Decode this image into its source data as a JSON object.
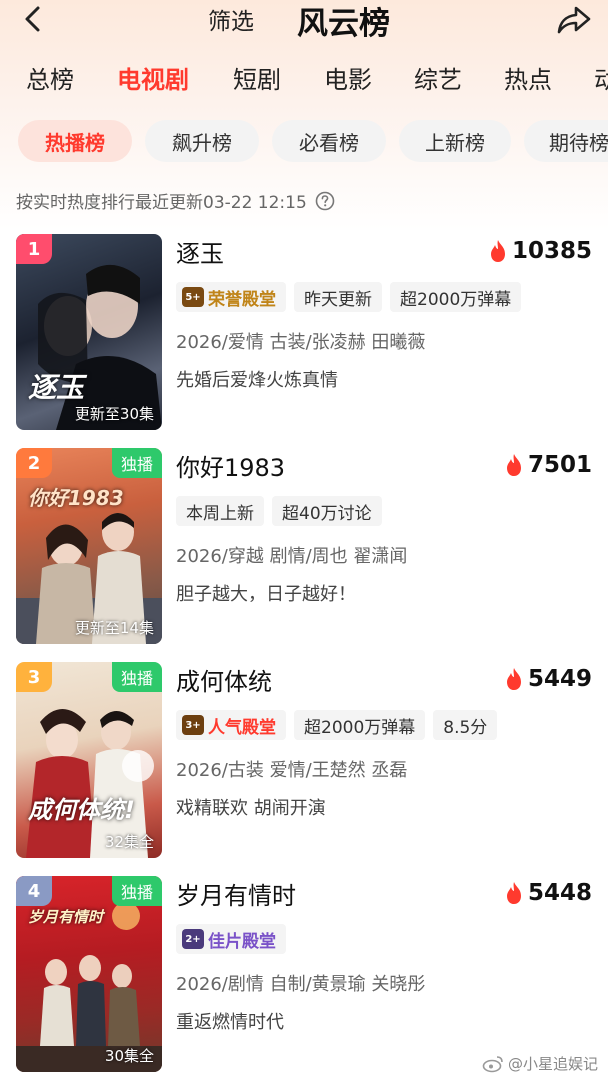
{
  "header": {
    "filter_label": "筛选",
    "title": "风云榜"
  },
  "tabs": [
    {
      "label": "总榜",
      "active": false
    },
    {
      "label": "电视剧",
      "active": true
    },
    {
      "label": "短剧",
      "active": false
    },
    {
      "label": "电影",
      "active": false
    },
    {
      "label": "综艺",
      "active": false
    },
    {
      "label": "热点",
      "active": false
    },
    {
      "label": "动",
      "active": false
    }
  ],
  "subtabs": [
    {
      "label": "热播榜",
      "active": true
    },
    {
      "label": "飙升榜",
      "active": false
    },
    {
      "label": "必看榜",
      "active": false
    },
    {
      "label": "上新榜",
      "active": false
    },
    {
      "label": "期待榜",
      "active": false
    }
  ],
  "update_text": "按实时热度排行最近更新03-22 12:15",
  "items": [
    {
      "rank": "1",
      "rank_color": "#ff4d6d",
      "title": "逐玉",
      "heat": "10385",
      "exclusive": "",
      "episodes": "更新至30集",
      "poster_text": "逐玉",
      "tags": [
        {
          "text": "荣誉殿堂",
          "type": "honor",
          "icon": "5+"
        },
        {
          "text": "昨天更新",
          "type": "plain"
        },
        {
          "text": "超2000万弹幕",
          "type": "plain"
        }
      ],
      "meta": "2026/爱情 古装/张凌赫 田曦薇",
      "desc": "先婚后爱烽火炼真情"
    },
    {
      "rank": "2",
      "rank_color": "#ff7a3d",
      "title": "你好1983",
      "heat": "7501",
      "exclusive": "独播",
      "episodes": "更新至14集",
      "poster_text": "你好1983",
      "tags": [
        {
          "text": "本周上新",
          "type": "plain"
        },
        {
          "text": "超40万讨论",
          "type": "plain"
        }
      ],
      "meta": "2026/穿越 剧情/周也 翟潇闻",
      "desc": "胆子越大，日子越好！"
    },
    {
      "rank": "3",
      "rank_color": "#ffb23d",
      "title": "成何体统",
      "heat": "5449",
      "exclusive": "独播",
      "episodes": "32集全",
      "poster_text": "成何体统!",
      "tags": [
        {
          "text": "人气殿堂",
          "type": "honor",
          "icon": "3+"
        },
        {
          "text": "超2000万弹幕",
          "type": "plain"
        },
        {
          "text": "8.5分",
          "type": "plain"
        }
      ],
      "meta": "2026/古装 爱情/王楚然 丞磊",
      "desc": "戏精联欢 胡闹开演"
    },
    {
      "rank": "4",
      "rank_color": "#8a9ac4",
      "title": "岁月有情时",
      "heat": "5448",
      "exclusive": "独播",
      "episodes": "30集全",
      "poster_text": "岁月有情时",
      "tags": [
        {
          "text": "佳片殿堂",
          "type": "honor-purple",
          "icon": "2+"
        }
      ],
      "meta": "2026/剧情 自制/黄景瑜 关晓彤",
      "desc": "重返燃情时代"
    }
  ],
  "watermark": "@小星追娱记",
  "colors": {
    "accent": "#ff3a2e",
    "fire": "#ff3a2e",
    "exclusive_green": "#2ec96b",
    "honor_gold": "#c08418",
    "honor_purple": "#7a52c8"
  }
}
